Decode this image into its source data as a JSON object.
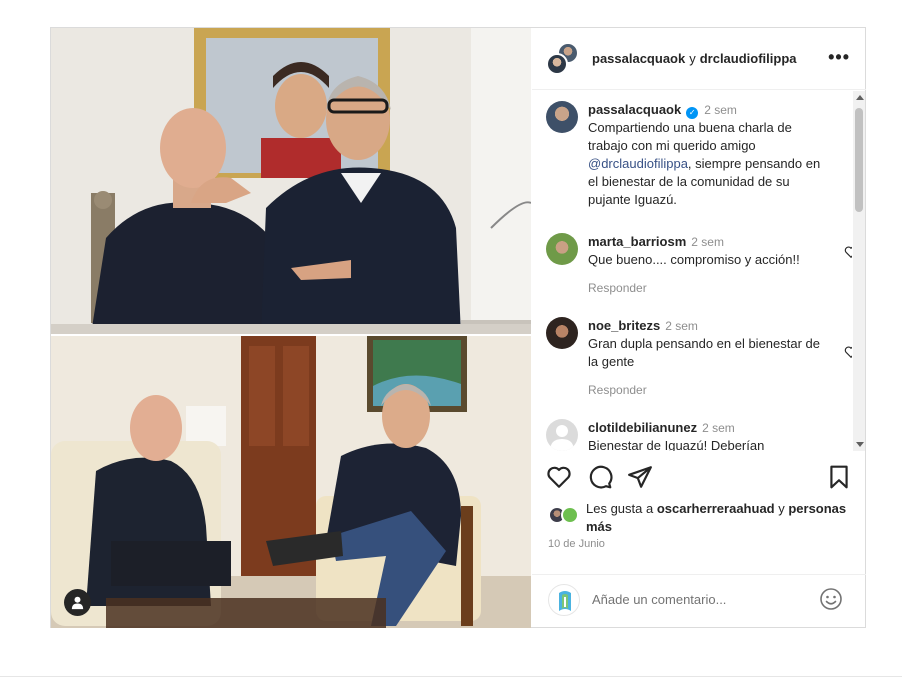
{
  "post": {
    "header": {
      "user_1": "passalacquaok",
      "connector": "y",
      "user_2": "drclaudiofilippa",
      "more_icon": "more-horizontal-icon"
    },
    "caption": {
      "username": "passalacquaok",
      "verified": true,
      "time": "2 sem",
      "text_before": "Compartiendo una buena charla de trabajo con mi querido amigo ",
      "mention": "@drclaudiofilippa",
      "text_after": ", siempre pensando en el bienestar de la comunidad de su pujante  Iguazú."
    },
    "comments": [
      {
        "username": "marta_barriosm",
        "time": "2 sem",
        "text": "Que bueno.... compromiso y acción!!",
        "reply": "Responder",
        "avatar_color": "#6f9a48"
      },
      {
        "username": "noe_britezs",
        "time": "2 sem",
        "text": "Gran dupla pensando en el bienestar de la gente",
        "reply": "Responder",
        "avatar_color": "#2e2420"
      },
      {
        "username": "clotildebilianunez",
        "time": "2 sem",
        "text": "Bienestar de Iguazú! Deberían",
        "reply": "",
        "avatar_color": "#dbdbdb"
      }
    ],
    "likes": {
      "prefix": "Les gusta a ",
      "user": "oscarherreraahuad",
      "suffix_connector": " y ",
      "others": "personas más"
    },
    "date": "10 de Junio",
    "comment_input": {
      "placeholder": "Añade un comentario..."
    },
    "icons": {
      "like": "heart-icon",
      "comment": "comment-icon",
      "share": "send-icon",
      "save": "bookmark-icon",
      "emoji": "emoji-icon",
      "tag": "user-tag-icon"
    },
    "colors": {
      "mention": "#385185",
      "verified": "#0095f6",
      "meta": "#8e8e8e"
    }
  }
}
